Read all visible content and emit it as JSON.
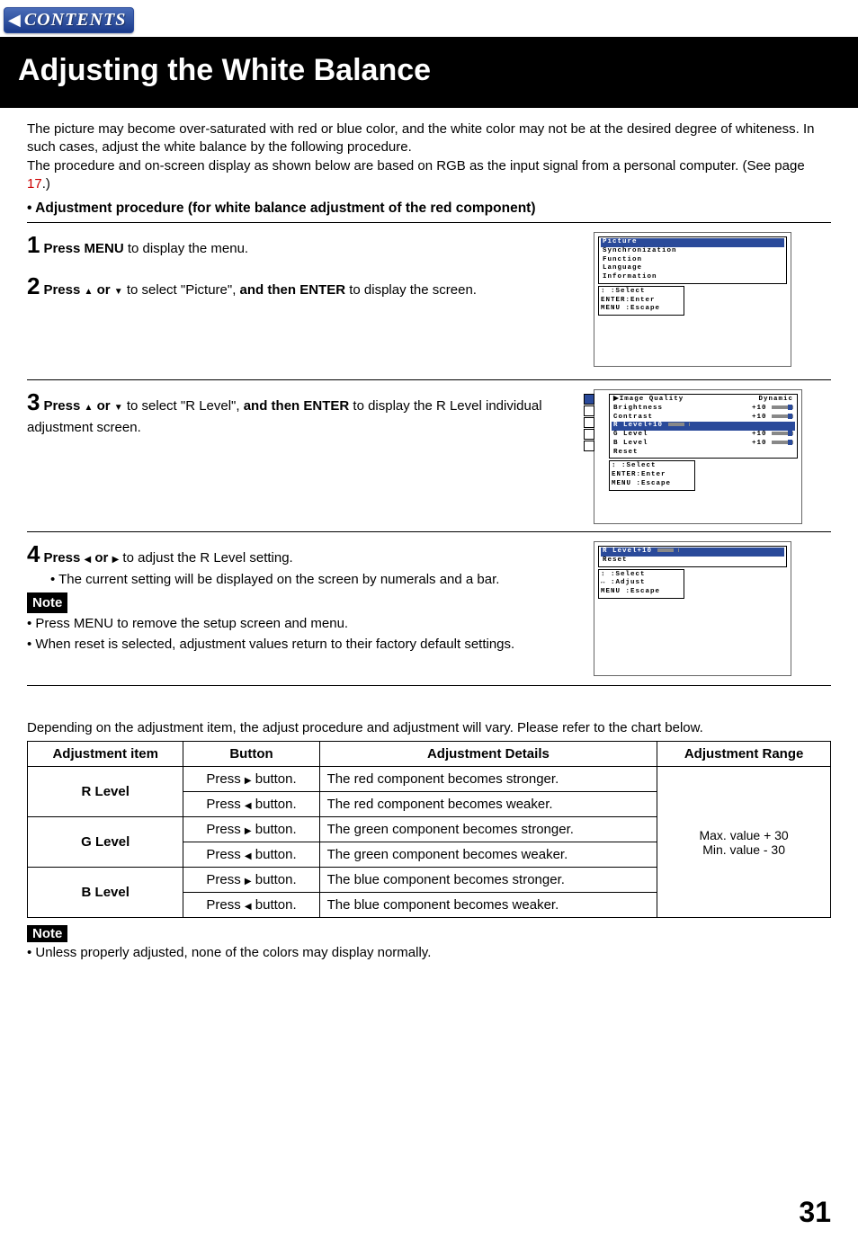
{
  "contents_label": "CONTENTS",
  "title": "Adjusting the White Balance",
  "intro_p1": "The picture may become over-saturated with red or blue color, and the white color may not be at the desired degree of whiteness. In such cases, adjust the white balance by the following procedure.",
  "intro_p2a": "The procedure and on-screen display as shown below are based on RGB as the input signal from a personal computer. (See page ",
  "intro_p2_page": "17",
  "intro_p2b": ".)",
  "proc_heading": "• Adjustment procedure (for white balance adjustment of the red component)",
  "step1_a": "Press MENU",
  "step1_b": " to display the menu.",
  "step2_a": "Press ",
  "step2_b": " or ",
  "step2_c": " to select \"Picture\", ",
  "step2_d": "and then ENTER",
  "step2_e": " to display the screen.",
  "step3_a": "Press ",
  "step3_b": " or ",
  "step3_c": " to select \"R Level\", ",
  "step3_d": "and then ENTER",
  "step3_e": " to display the R Level individual adjustment screen.",
  "step4_a": "Press ",
  "step4_b": " or ",
  "step4_c": " to adjust the R Level setting.",
  "step4_bullet": "• The current setting will be displayed on the screen by numerals and a bar.",
  "note_label": "Note",
  "note1_1": "• Press MENU to remove the setup screen and menu.",
  "note1_2": "• When reset is selected, adjustment values return to their factory default settings.",
  "table_intro": "Depending on the adjustment item, the adjust procedure and adjustment will vary. Please refer to the chart below.",
  "th_item": "Adjustment item",
  "th_button": "Button",
  "th_details": "Adjustment Details",
  "th_range": "Adjustment Range",
  "rows": {
    "r_label": "R Level",
    "g_label": "G Level",
    "b_label": "B Level",
    "press_r": "Press ",
    "press_suffix": " button.",
    "r_strong": "The red component becomes stronger.",
    "r_weak": "The red component becomes weaker.",
    "g_strong": "The green component becomes stronger.",
    "g_weak": "The green component becomes weaker.",
    "b_strong": "The blue component becomes stronger.",
    "b_weak": "The blue component becomes weaker.",
    "range1": "Max. value   + 30",
    "range2": "Min. value    - 30"
  },
  "note2": "• Unless properly adjusted, none of the colors may display normally.",
  "osd1": {
    "i0": "Picture",
    "i1": "Synchronization",
    "i2": "Function",
    "i3": "Language",
    "i4": "Information",
    "l1": " ↕   :Select",
    "l2": "ENTER:Enter",
    "l3": "MENU :Escape"
  },
  "osd2": {
    "h0": "Image Quality",
    "h0v": "Dynamic",
    "r1": "Brightness",
    "v1": "+10",
    "r2": "Contrast",
    "v2": "+10",
    "r3": "R Level",
    "v3": "+10",
    "r4": "G Level",
    "v4": "+10",
    "r5": "B Level",
    "v5": "+10",
    "r6": "Reset",
    "l1": " ↕   :Select",
    "l2": "ENTER:Enter",
    "l3": "MENU :Escape"
  },
  "osd3": {
    "r1": "R Level",
    "v1": "+10",
    "r2": "Reset",
    "l1": " ↕   :Select",
    "l2": " ↔   :Adjust",
    "l3": "MENU :Escape"
  },
  "page_number": "31"
}
